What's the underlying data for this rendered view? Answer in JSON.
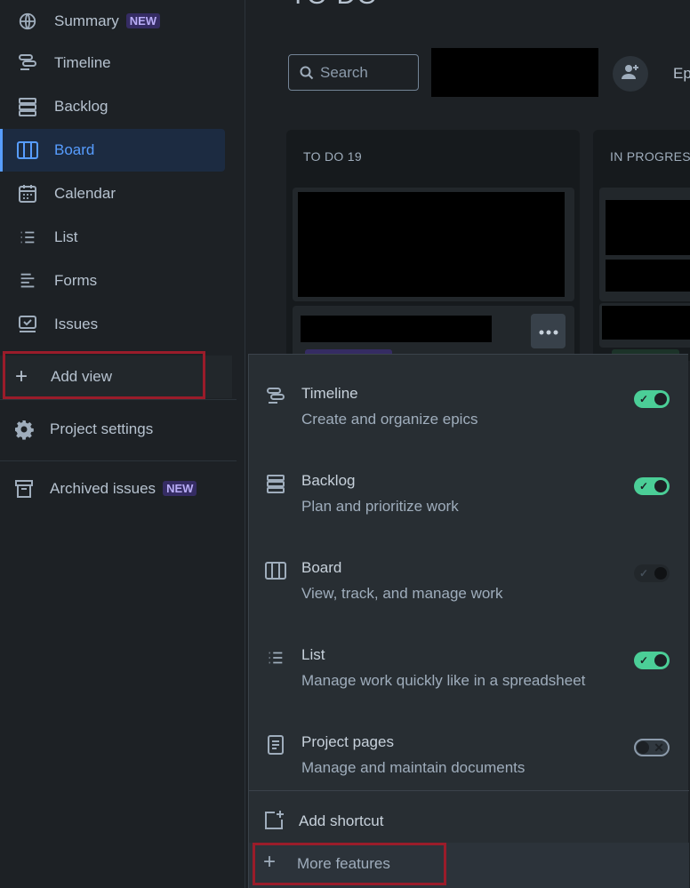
{
  "sidebar": {
    "items": [
      {
        "label": "Summary",
        "badge": "NEW",
        "icon": "globe-icon"
      },
      {
        "label": "Timeline",
        "icon": "timeline-icon"
      },
      {
        "label": "Backlog",
        "icon": "backlog-icon"
      },
      {
        "label": "Board",
        "icon": "board-icon",
        "active": true
      },
      {
        "label": "Calendar",
        "icon": "calendar-icon"
      },
      {
        "label": "List",
        "icon": "list-icon"
      },
      {
        "label": "Forms",
        "icon": "forms-icon"
      },
      {
        "label": "Issues",
        "icon": "issues-icon"
      }
    ],
    "add_view": "Add view",
    "project_settings": "Project settings",
    "archived_issues": "Archived issues",
    "archived_badge": "NEW"
  },
  "header": {
    "title": "TO DO",
    "search_label": "Search",
    "epic_label": "Ep"
  },
  "board": {
    "columns": [
      {
        "title": "TO DO 19"
      },
      {
        "title": "IN PROGRESS"
      }
    ]
  },
  "features_menu": {
    "items": [
      {
        "name": "Timeline",
        "description": "Create and organize epics",
        "enabled": true
      },
      {
        "name": "Backlog",
        "description": "Plan and prioritize work",
        "enabled": true
      },
      {
        "name": "Board",
        "description": "View, track, and manage work",
        "enabled": true,
        "locked": true
      },
      {
        "name": "List",
        "description": "Manage work quickly like in a spreadsheet",
        "enabled": true
      },
      {
        "name": "Project pages",
        "description": "Manage and maintain documents",
        "enabled": false
      }
    ],
    "add_shortcut": "Add shortcut",
    "more_features": "More features"
  },
  "colors": {
    "accent": "#579dff",
    "toggle_on": "#4bce97",
    "highlight_box": "#9a1c2a",
    "background": "#1d2125"
  }
}
